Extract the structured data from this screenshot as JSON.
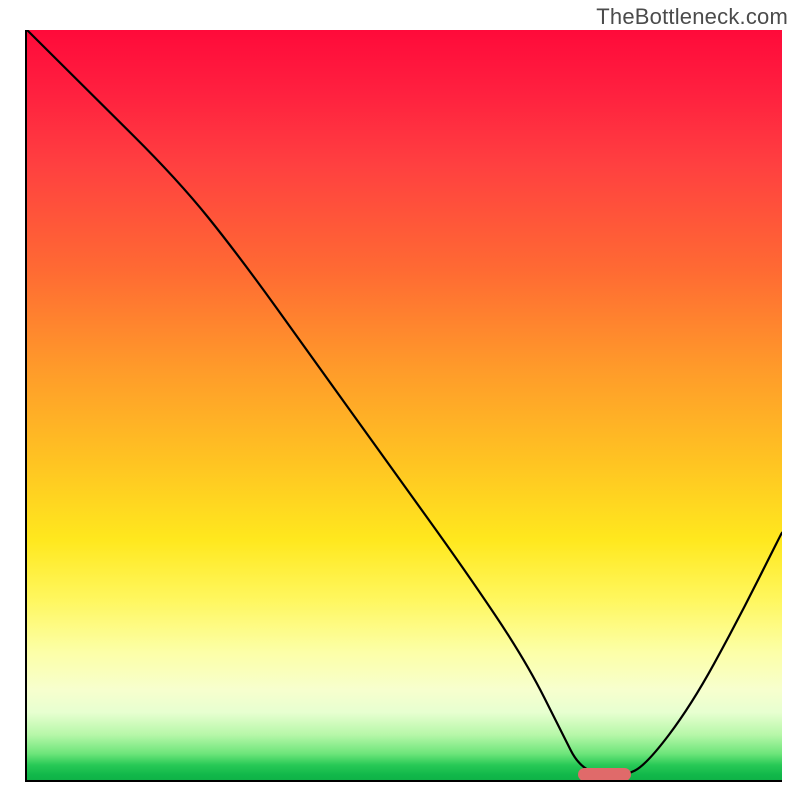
{
  "watermark": "TheBottleneck.com",
  "chart_data": {
    "type": "line",
    "title": "",
    "xlabel": "",
    "ylabel": "",
    "xlim": [
      0,
      100
    ],
    "ylim": [
      0,
      100
    ],
    "x": [
      0,
      8,
      20,
      28,
      38,
      48,
      58,
      66,
      71,
      73,
      76,
      79,
      82,
      88,
      94,
      100
    ],
    "values": [
      100,
      92,
      80,
      70,
      56,
      42,
      28,
      16,
      6,
      2,
      0.5,
      0.5,
      2,
      10,
      21,
      33
    ],
    "marker": {
      "x_start": 73,
      "x_end": 80,
      "y": 0.7
    },
    "gradient_stops": [
      {
        "pct": 0,
        "color": "#ff0a3a"
      },
      {
        "pct": 18,
        "color": "#ff4040"
      },
      {
        "pct": 45,
        "color": "#ff9a2a"
      },
      {
        "pct": 68,
        "color": "#ffe81e"
      },
      {
        "pct": 88,
        "color": "#f7ffce"
      },
      {
        "pct": 100,
        "color": "#0fb247"
      }
    ]
  }
}
